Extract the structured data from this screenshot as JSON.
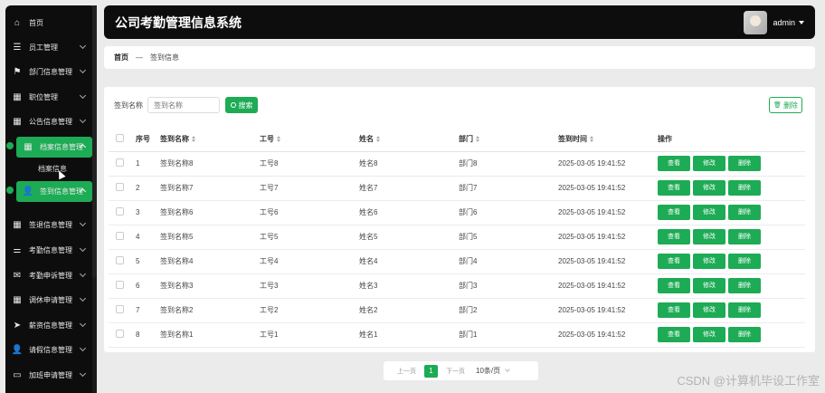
{
  "app": {
    "title": "公司考勤管理信息系统",
    "user": "admin"
  },
  "breadcrumb": {
    "home": "首页",
    "separator": "—",
    "current": "签到信息"
  },
  "sidebar": {
    "items": [
      {
        "label": "首页",
        "icon": "home-icon"
      },
      {
        "label": "员工管理",
        "icon": "list-icon"
      },
      {
        "label": "部门信息管理",
        "icon": "flag-icon"
      },
      {
        "label": "职位管理",
        "icon": "grid-icon"
      },
      {
        "label": "公告信息管理",
        "icon": "grid-icon"
      },
      {
        "label": "档案信息管理",
        "icon": "grid-icon"
      },
      {
        "label": "签到信息管理",
        "icon": "user-icon"
      },
      {
        "label": "签退信息管理",
        "icon": "grid-icon"
      },
      {
        "label": "考勤信息管理",
        "icon": "sliders-icon"
      },
      {
        "label": "考勤申诉管理",
        "icon": "chat-icon"
      },
      {
        "label": "调休申请管理",
        "icon": "grid-icon"
      },
      {
        "label": "薪资信息管理",
        "icon": "send-icon"
      },
      {
        "label": "请假信息管理",
        "icon": "user-icon"
      },
      {
        "label": "加班申请管理",
        "icon": "message-icon"
      }
    ],
    "sub_item": "档案信息"
  },
  "search": {
    "label": "签到名称",
    "placeholder": "签到名称",
    "button": "搜索"
  },
  "toolbar": {
    "delete": "删除"
  },
  "table": {
    "headers": [
      "序号",
      "签到名称",
      "工号",
      "姓名",
      "部门",
      "签到时间",
      "操作"
    ],
    "rows": [
      {
        "no": "1",
        "name": "签到名称8",
        "id": "工号8",
        "person": "姓名8",
        "dept": "部门8",
        "time": "2025-03-05 19:41:52"
      },
      {
        "no": "2",
        "name": "签到名称7",
        "id": "工号7",
        "person": "姓名7",
        "dept": "部门7",
        "time": "2025-03-05 19:41:52"
      },
      {
        "no": "3",
        "name": "签到名称6",
        "id": "工号6",
        "person": "姓名6",
        "dept": "部门6",
        "time": "2025-03-05 19:41:52"
      },
      {
        "no": "4",
        "name": "签到名称5",
        "id": "工号5",
        "person": "姓名5",
        "dept": "部门5",
        "time": "2025-03-05 19:41:52"
      },
      {
        "no": "5",
        "name": "签到名称4",
        "id": "工号4",
        "person": "姓名4",
        "dept": "部门4",
        "time": "2025-03-05 19:41:52"
      },
      {
        "no": "6",
        "name": "签到名称3",
        "id": "工号3",
        "person": "姓名3",
        "dept": "部门3",
        "time": "2025-03-05 19:41:52"
      },
      {
        "no": "7",
        "name": "签到名称2",
        "id": "工号2",
        "person": "姓名2",
        "dept": "部门2",
        "time": "2025-03-05 19:41:52"
      },
      {
        "no": "8",
        "name": "签到名称1",
        "id": "工号1",
        "person": "姓名1",
        "dept": "部门1",
        "time": "2025-03-05 19:41:52"
      }
    ],
    "actions": {
      "view": "查看",
      "edit": "修改",
      "delete": "删除"
    }
  },
  "pagination": {
    "prev": "上一页",
    "page": "1",
    "next": "下一页",
    "size": "10条/页"
  },
  "watermark": "CSDN @计算机毕设工作室",
  "colors": {
    "accent": "#1dab55",
    "sidebar_bg": "#0d0d0d"
  }
}
